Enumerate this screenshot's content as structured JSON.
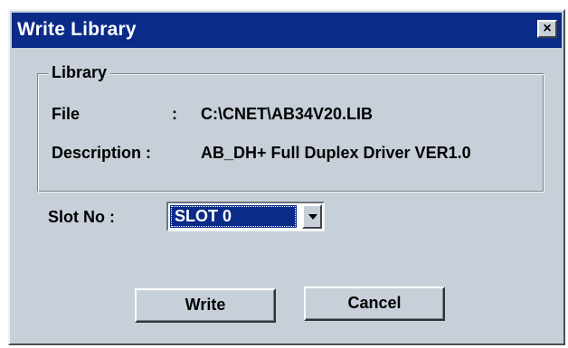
{
  "window": {
    "title": "Write Library",
    "close_symbol": "×"
  },
  "library": {
    "legend": "Library",
    "file_label": "File",
    "file_sep": ":",
    "file_value": "C:\\CNET\\AB34V20.LIB",
    "description_label": "Description :",
    "description_value": "AB_DH+ Full Duplex Driver VER1.0"
  },
  "slot": {
    "label": "Slot No :",
    "selected": "SLOT 0"
  },
  "buttons": {
    "write": "Write",
    "cancel": "Cancel"
  }
}
